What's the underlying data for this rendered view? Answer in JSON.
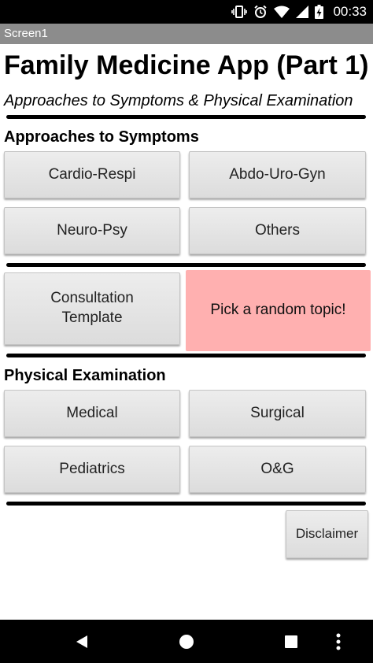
{
  "status_bar": {
    "time": "00:33"
  },
  "screen_title": "Screen1",
  "app": {
    "title": "Family Medicine App (Part 1)",
    "subtitle": "Approaches to Symptoms & Physical Examination"
  },
  "symptoms_section": {
    "title": "Approaches to Symptoms",
    "buttons": [
      "Cardio-Respi",
      "Abdo-Uro-Gyn",
      "Neuro-Psy",
      "Others"
    ]
  },
  "middle": {
    "consultation_label": "Consultation\nTemplate",
    "random_label": "Pick a random topic!"
  },
  "exam_section": {
    "title": "Physical Examination",
    "buttons": [
      "Medical",
      "Surgical",
      "Pediatrics",
      "O&G"
    ]
  },
  "disclaimer_label": "Disclaimer",
  "colors": {
    "random_button": "#ffb0b0",
    "title_bar": "#8c8c8c"
  },
  "nav_icons": [
    "back-icon",
    "home-icon",
    "recents-icon",
    "more-icon"
  ]
}
